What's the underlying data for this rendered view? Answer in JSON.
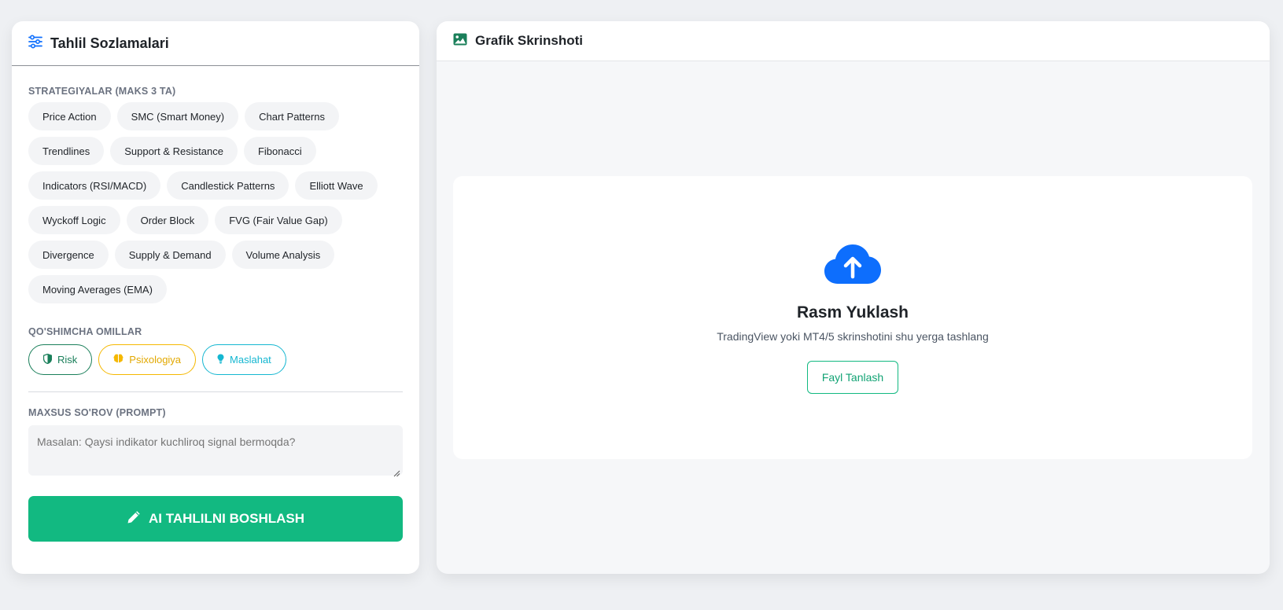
{
  "left_panel": {
    "title": "Tahlil Sozlamalari",
    "strategies_label": "STRATEGIYALAR (MAKS 3 TA)",
    "strategies": [
      "Price Action",
      "SMC (Smart Money)",
      "Chart Patterns",
      "Trendlines",
      "Support & Resistance",
      "Fibonacci",
      "Indicators (RSI/MACD)",
      "Candlestick Patterns",
      "Elliott Wave",
      "Wyckoff Logic",
      "Order Block",
      "FVG (Fair Value Gap)",
      "Divergence",
      "Supply & Demand",
      "Volume Analysis",
      "Moving Averages (EMA)"
    ],
    "extra_label": "QO'SHIMCHA OMILLAR",
    "factors": {
      "risk": "Risk",
      "psychology": "Psixologiya",
      "advice": "Maslahat"
    },
    "prompt_label": "MAXSUS SO'ROV (PROMPT)",
    "prompt_placeholder": "Masalan: Qaysi indikator kuchliroq signal bermoqda?",
    "start_button": "AI TAHLILNI BOSHLASH"
  },
  "right_panel": {
    "title": "Grafik Skrinshoti",
    "upload_title": "Rasm Yuklash",
    "upload_subtitle": "TradingView yoki MT4/5 skrinshotini shu yerga tashlang",
    "file_button": "Fayl Tanlash"
  },
  "colors": {
    "accent_green": "#12b981",
    "upload_blue": "#0d6efd",
    "risk_green": "#1a7f5a",
    "psychology_yellow": "#f5b800",
    "advice_cyan": "#15b7d1"
  },
  "icons": {
    "settings": "sliders-icon",
    "image": "image-icon",
    "upload": "cloud-upload-icon",
    "risk": "shield-icon",
    "psychology": "brain-icon",
    "advice": "lightbulb-icon",
    "start": "pencil-icon"
  }
}
